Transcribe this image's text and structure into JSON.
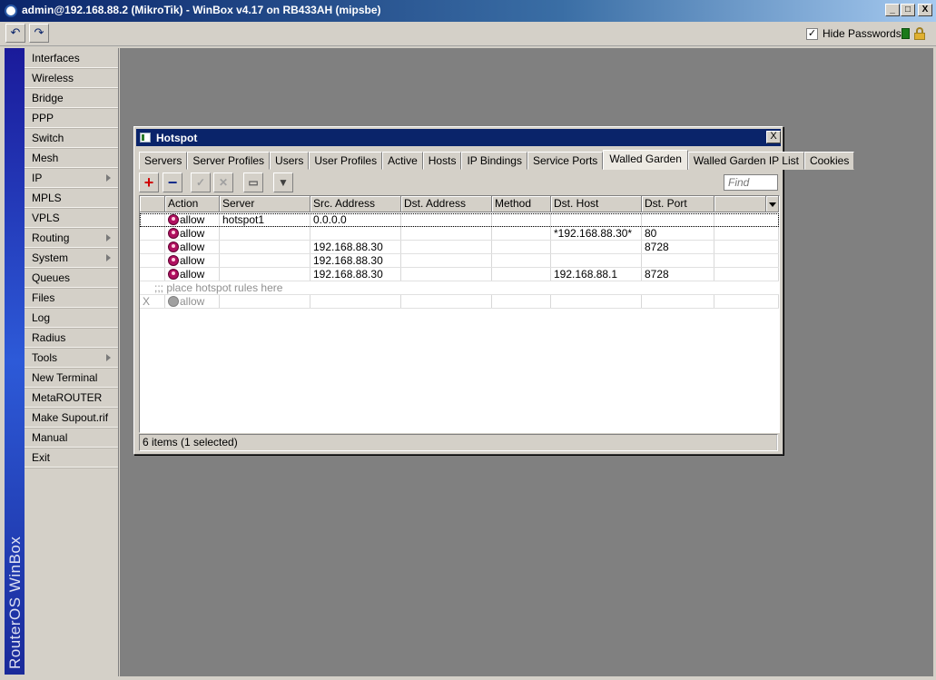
{
  "window": {
    "title": "admin@192.168.88.2 (MikroTik) - WinBox v4.17 on RB433AH (mipsbe)",
    "minimize": "_",
    "maximize": "□",
    "close": "X"
  },
  "toolbar": {
    "undo_icon": "undo-icon",
    "redo_icon": "redo-icon",
    "hide_passwords_label": "Hide Passwords",
    "hide_passwords_checked": "✓"
  },
  "sidebar": {
    "brand": "RouterOS WinBox",
    "items": [
      {
        "label": "Interfaces",
        "submenu": false
      },
      {
        "label": "Wireless",
        "submenu": false
      },
      {
        "label": "Bridge",
        "submenu": false
      },
      {
        "label": "PPP",
        "submenu": false
      },
      {
        "label": "Switch",
        "submenu": false
      },
      {
        "label": "Mesh",
        "submenu": false
      },
      {
        "label": "IP",
        "submenu": true
      },
      {
        "label": "MPLS",
        "submenu": false
      },
      {
        "label": "VPLS",
        "submenu": false
      },
      {
        "label": "Routing",
        "submenu": true
      },
      {
        "label": "System",
        "submenu": true
      },
      {
        "label": "Queues",
        "submenu": false
      },
      {
        "label": "Files",
        "submenu": false
      },
      {
        "label": "Log",
        "submenu": false
      },
      {
        "label": "Radius",
        "submenu": false
      },
      {
        "label": "Tools",
        "submenu": true
      },
      {
        "label": "New Terminal",
        "submenu": false
      },
      {
        "label": "MetaROUTER",
        "submenu": false
      },
      {
        "label": "Make Supout.rif",
        "submenu": false
      },
      {
        "label": "Manual",
        "submenu": false
      },
      {
        "label": "Exit",
        "submenu": false
      }
    ]
  },
  "hotspot": {
    "title": "Hotspot",
    "close": "X",
    "tabs": [
      "Servers",
      "Server Profiles",
      "Users",
      "User Profiles",
      "Active",
      "Hosts",
      "IP Bindings",
      "Service Ports",
      "Walled Garden",
      "Walled Garden IP List",
      "Cookies"
    ],
    "active_tab": "Walled Garden",
    "buttons": {
      "add": "+",
      "remove": "−",
      "enable": "✓",
      "disable": "✕",
      "comment": "▭",
      "filter": "▼"
    },
    "find_placeholder": "Find",
    "columns": [
      "",
      "Action",
      "Server",
      "Src. Address",
      "Dst. Address",
      "Method",
      "Dst. Host",
      "Dst. Port"
    ],
    "rows": [
      {
        "flag": "",
        "action": "allow",
        "server": "hotspot1",
        "src": "0.0.0.0",
        "dst": "",
        "method": "",
        "host": "",
        "port": ""
      },
      {
        "flag": "",
        "action": "allow",
        "server": "",
        "src": "",
        "dst": "",
        "method": "",
        "host": "*192.168.88.30*",
        "port": "80"
      },
      {
        "flag": "",
        "action": "allow",
        "server": "",
        "src": "192.168.88.30",
        "dst": "",
        "method": "",
        "host": "",
        "port": "8728"
      },
      {
        "flag": "",
        "action": "allow",
        "server": "",
        "src": "192.168.88.30",
        "dst": "",
        "method": "",
        "host": "",
        "port": ""
      },
      {
        "flag": "",
        "action": "allow",
        "server": "",
        "src": "192.168.88.30",
        "dst": "",
        "method": "",
        "host": "192.168.88.1",
        "port": "8728"
      }
    ],
    "comment_row": ";;; place hotspot rules here",
    "disabled_row": {
      "flag": "X",
      "action": "allow"
    },
    "status": "6 items (1 selected)"
  },
  "colors": {
    "title_bar": "#0a246a",
    "workspace": "#808080",
    "brand_strip": "#2d5ad8",
    "allow_icon": "#b01060"
  }
}
